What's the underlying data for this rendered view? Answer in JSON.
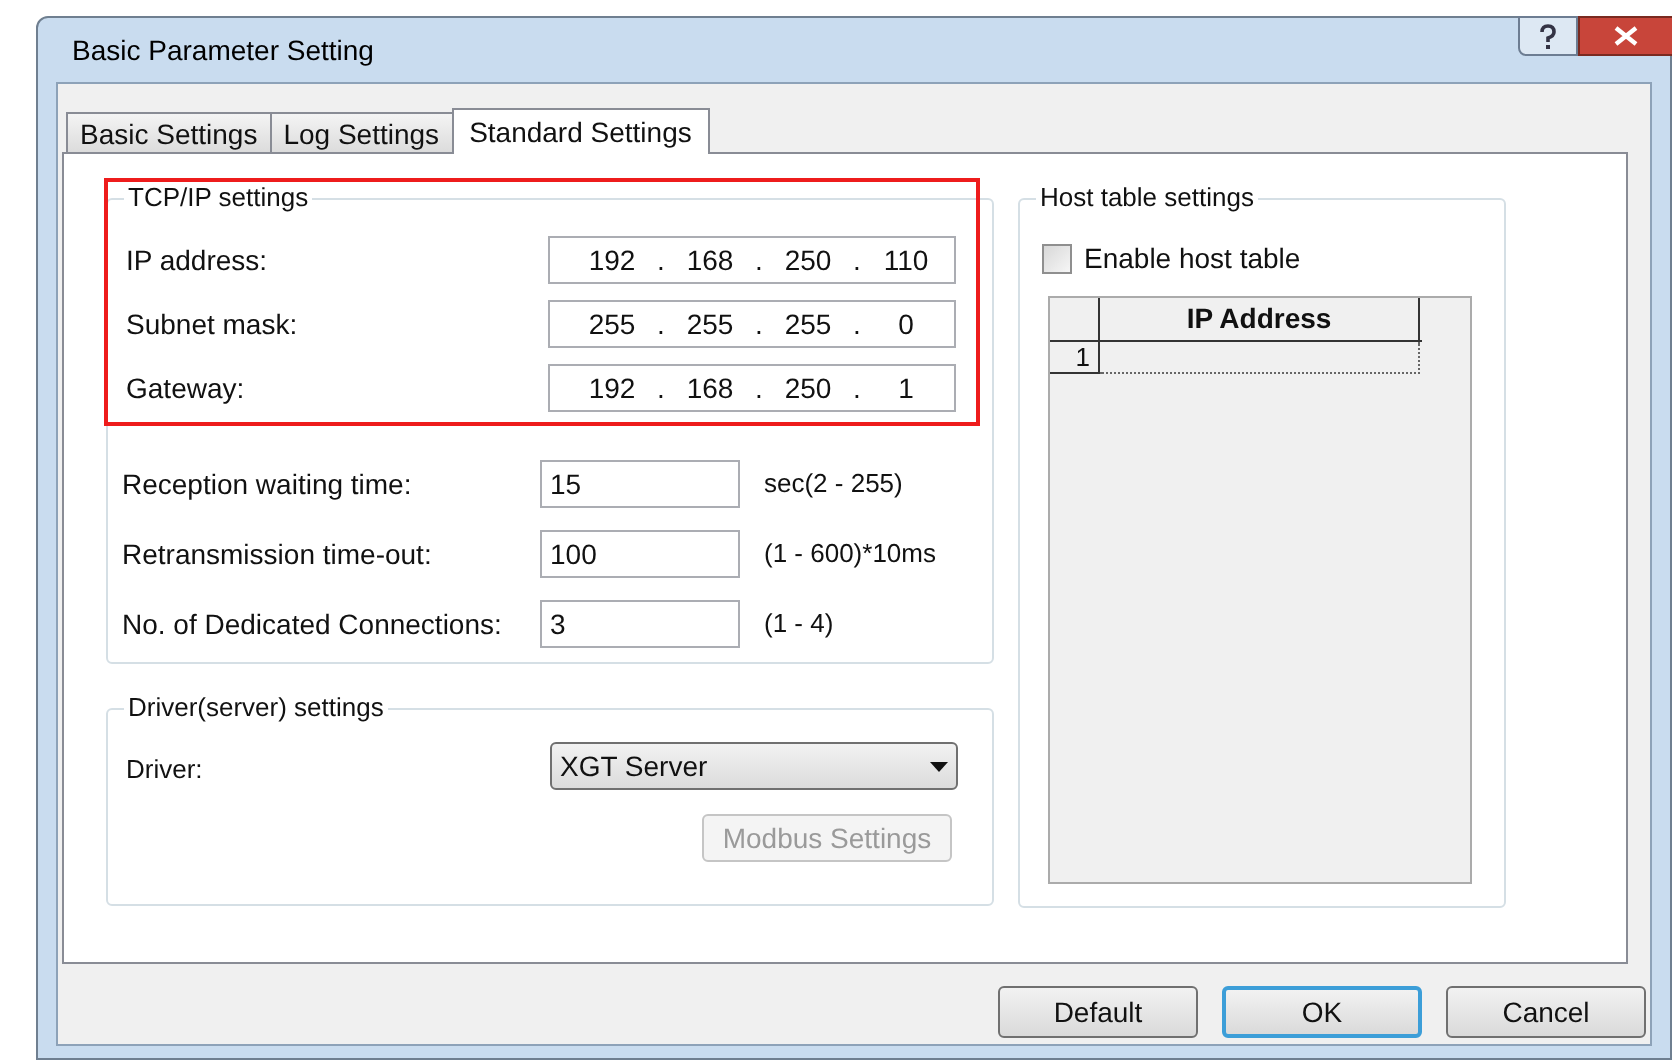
{
  "window": {
    "title": "Basic Parameter Setting"
  },
  "tabs": [
    {
      "label": "Basic Settings",
      "selected": false
    },
    {
      "label": "Log Settings",
      "selected": false
    },
    {
      "label": "Standard Settings",
      "selected": true
    }
  ],
  "tcpip": {
    "title": "TCP/IP settings",
    "highlighted": true,
    "separator": ".",
    "fields": [
      {
        "label": "IP address:",
        "octets": [
          "192",
          "168",
          "250",
          "110"
        ]
      },
      {
        "label": "Subnet mask:",
        "octets": [
          "255",
          "255",
          "255",
          "0"
        ]
      },
      {
        "label": "Gateway:",
        "octets": [
          "192",
          "168",
          "250",
          "1"
        ]
      }
    ]
  },
  "timing": [
    {
      "label": "Reception waiting time:",
      "value": "15",
      "hint": "sec(2 - 255)"
    },
    {
      "label": "Retransmission time-out:",
      "value": "100",
      "hint": "(1 - 600)*10ms"
    },
    {
      "label": "No. of Dedicated Connections:",
      "value": "3",
      "hint": "(1 - 4)"
    }
  ],
  "driver": {
    "title": "Driver(server) settings",
    "label": "Driver:",
    "value": "XGT Server",
    "button": {
      "label": "Modbus Settings",
      "disabled": true
    }
  },
  "host": {
    "title": "Host table settings",
    "checkbox": {
      "label": "Enable host table",
      "checked": false
    },
    "columns": [
      "IP Address"
    ],
    "rows": [
      {
        "index": "1",
        "ip": ""
      }
    ]
  },
  "buttons": [
    {
      "label": "Default",
      "focused": false
    },
    {
      "label": "OK",
      "focused": true
    },
    {
      "label": "Cancel",
      "focused": false
    }
  ]
}
